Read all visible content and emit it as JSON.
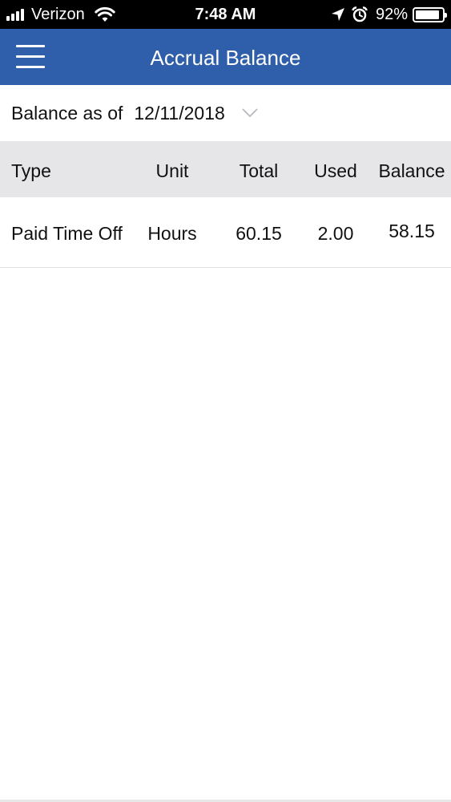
{
  "status_bar": {
    "carrier": "Verizon",
    "time": "7:48 AM",
    "battery_percent": "92%",
    "battery_level": 0.92,
    "icons": [
      "signal-bars-icon",
      "wifi-icon",
      "location-arrow-icon",
      "alarm-clock-icon",
      "battery-icon"
    ]
  },
  "header": {
    "title": "Accrual Balance",
    "menu_icon": "hamburger-menu-icon",
    "background_color": "#2f5faa"
  },
  "balance_filter": {
    "label": "Balance as of",
    "date": "12/11/2018",
    "dropdown_icon": "chevron-down-icon"
  },
  "table": {
    "columns": [
      "Type",
      "Unit",
      "Total",
      "Used",
      "Balance"
    ],
    "rows": [
      {
        "type": "Paid Time Off",
        "unit": "Hours",
        "total": "60.15",
        "used": "2.00",
        "balance": "58.15"
      }
    ]
  }
}
